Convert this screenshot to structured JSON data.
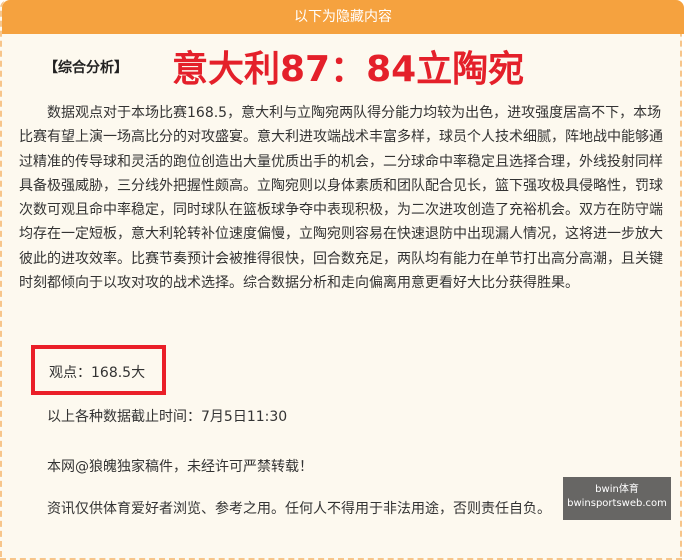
{
  "header": {
    "banner": "以下为隐藏内容"
  },
  "title_row": {
    "section_label": "【综合分析】",
    "headline": "意大利87：84立陶宛"
  },
  "article": {
    "paragraph": "数据观点对于本场比赛168.5，意大利与立陶宛两队得分能力均较为出色，进攻强度居高不下，本场比赛有望上演一场高比分的对攻盛宴。意大利进攻端战术丰富多样，球员个人技术细腻，阵地战中能够通过精准的传导球和灵活的跑位创造出大量优质出手的机会，二分球命中率稳定且选择合理，外线投射同样具备极强威胁，三分线外把握性颇高。立陶宛则以身体素质和团队配合见长，篮下强攻极具侵略性，罚球次数可观且命中率稳定，同时球队在篮板球争夺中表现积极，为二次进攻创造了充裕机会。双方在防守端均存在一定短板，意大利轮转补位速度偏慢，立陶宛则容易在快速退防中出现漏人情况，这将进一步放大彼此的进攻效率。比赛节奏预计会被推得很快，回合数充足，两队均有能力在单节打出高分高潮，且关键时刻都倾向于以攻对攻的战术选择。综合数据分析和走向偏离用意更看好大比分获得胜果。",
    "view": "观点：168.5大",
    "cutoff": "以上各种数据截止时间：7月5日11:30",
    "copyright": "本网@狼魄独家稿件，未经许可严禁转载！",
    "disclaimer": "资讯仅供体育爱好者浏览、参考之用。任何人不得用于非法用途，否则责任自负。"
  },
  "watermark": {
    "line1": "bwin体育",
    "line2": "bwinsportsweb.com"
  }
}
